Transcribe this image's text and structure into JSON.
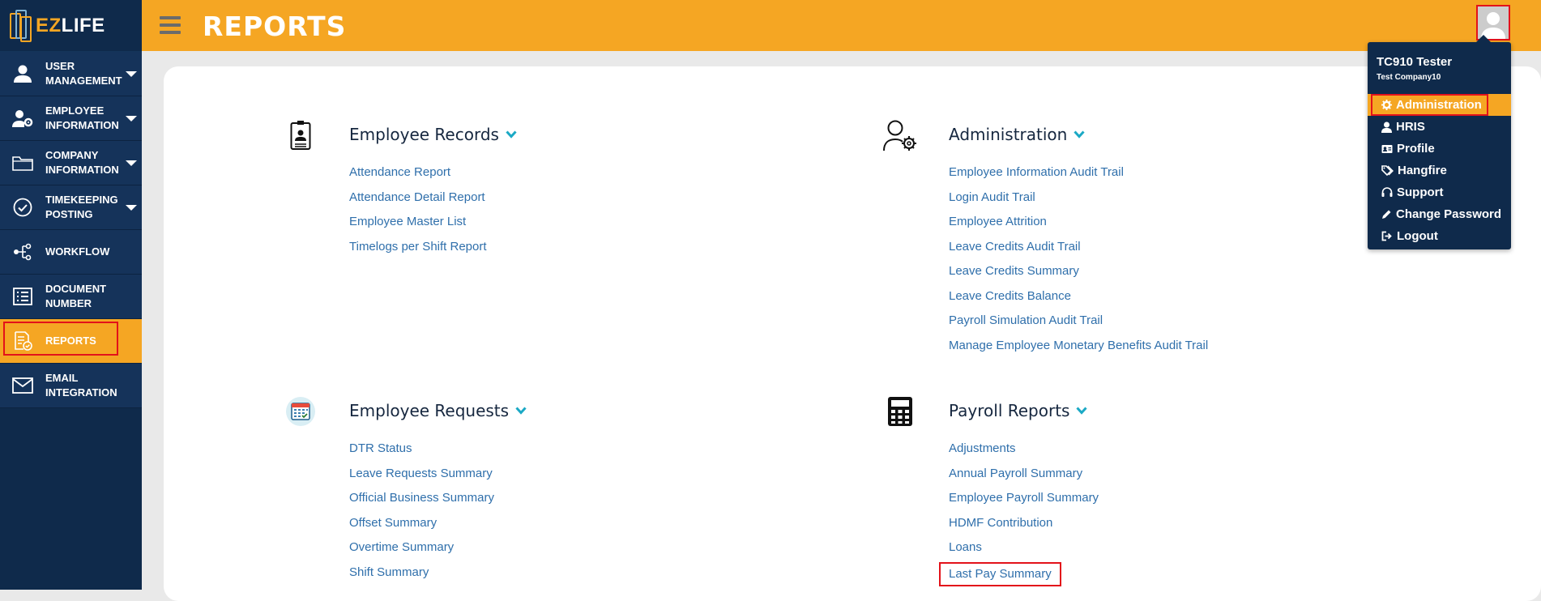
{
  "app": {
    "logo_text_1": "EZ",
    "logo_text_2": "LIFE"
  },
  "header": {
    "title": "REPORTS"
  },
  "sidebar": {
    "items": [
      {
        "label": "User Management",
        "icon": "user-icon",
        "dropdown": true
      },
      {
        "label": "Employee Information",
        "icon": "user-cog-icon",
        "dropdown": true
      },
      {
        "label": "Company Information",
        "icon": "folder-icon",
        "dropdown": true
      },
      {
        "label": "Timekeeping Posting",
        "icon": "check-circle-icon",
        "dropdown": true
      },
      {
        "label": "Workflow",
        "icon": "workflow-icon",
        "dropdown": false
      },
      {
        "label": "Document Number",
        "icon": "list-icon",
        "dropdown": false
      },
      {
        "label": "Reports",
        "icon": "report-icon",
        "dropdown": false,
        "active": true
      },
      {
        "label": "Email Integration",
        "icon": "mail-icon",
        "dropdown": false
      }
    ]
  },
  "sections": {
    "employee_records": {
      "title": "Employee Records",
      "links": [
        "Attendance Report",
        "Attendance Detail Report",
        "Employee Master List",
        "Timelogs per Shift Report"
      ]
    },
    "administration": {
      "title": "Administration",
      "links": [
        "Employee Information Audit Trail",
        "Login Audit Trail",
        "Employee Attrition",
        "Leave Credits Audit Trail",
        "Leave Credits Summary",
        "Leave Credits Balance",
        "Payroll Simulation Audit Trail",
        "Manage Employee Monetary Benefits Audit Trail"
      ]
    },
    "employee_requests": {
      "title": "Employee Requests",
      "links": [
        "DTR Status",
        "Leave Requests Summary",
        "Official Business Summary",
        "Offset Summary",
        "Overtime Summary",
        "Shift Summary"
      ]
    },
    "payroll_reports": {
      "title": "Payroll Reports",
      "links": [
        "Adjustments",
        "Annual Payroll Summary",
        "Employee Payroll Summary",
        "HDMF Contribution",
        "Loans",
        "Last Pay Summary"
      ]
    }
  },
  "user_menu": {
    "name": "TC910 Tester",
    "company": "Test Company10",
    "items": [
      {
        "label": "Administration",
        "icon": "gear-icon",
        "active": true
      },
      {
        "label": "HRIS",
        "icon": "user-icon"
      },
      {
        "label": "Profile",
        "icon": "id-card-icon"
      },
      {
        "label": "Hangfire",
        "icon": "tags-icon"
      },
      {
        "label": "Support",
        "icon": "headset-icon"
      },
      {
        "label": "Change Password",
        "icon": "pencil-icon"
      },
      {
        "label": "Logout",
        "icon": "sign-out-icon"
      }
    ]
  },
  "colors": {
    "sidebar": "#0f2a4b",
    "accent": "#f5a623",
    "link": "#2f6fab",
    "highlight": "#e3121a"
  }
}
